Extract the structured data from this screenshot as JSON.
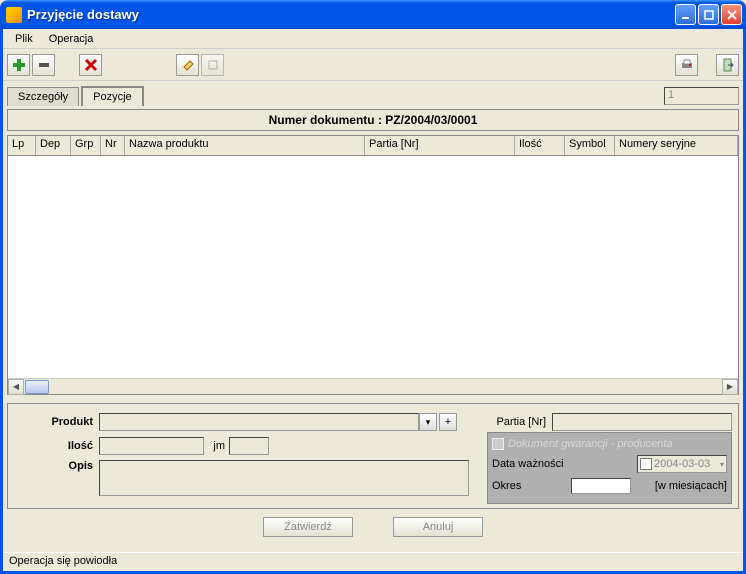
{
  "window": {
    "title": "Przyjęcie dostawy"
  },
  "menu": {
    "file": "Plik",
    "operation": "Operacja"
  },
  "tabs": {
    "details": "Szczegóły",
    "items": "Pozycje",
    "page": "1"
  },
  "doc": {
    "header_label": "Numer dokumentu :",
    "number": "PZ/2004/03/0001"
  },
  "columns": {
    "lp": "Lp",
    "dep": "Dep",
    "grp": "Grp",
    "nr": "Nr",
    "product_name": "Nazwa produktu",
    "batch": "Partia [Nr]",
    "qty": "Ilość",
    "symbol": "Symbol",
    "serials": "Numery seryjne"
  },
  "form": {
    "product_label": "Produkt",
    "qty_label": "Ilość",
    "unit_label": "jm",
    "desc_label": "Opis",
    "batch_label": "Partia [Nr]",
    "plus": "+"
  },
  "warranty": {
    "title": "Dokument gwarancji - producenta",
    "expiry_label": "Data ważności",
    "period_label": "Okres",
    "period_unit": "[w miesiącach]",
    "date": "2004-03-03"
  },
  "buttons": {
    "confirm": "Zatwierdź",
    "cancel": "Anuluj"
  },
  "status": "Operacja się powiodła"
}
